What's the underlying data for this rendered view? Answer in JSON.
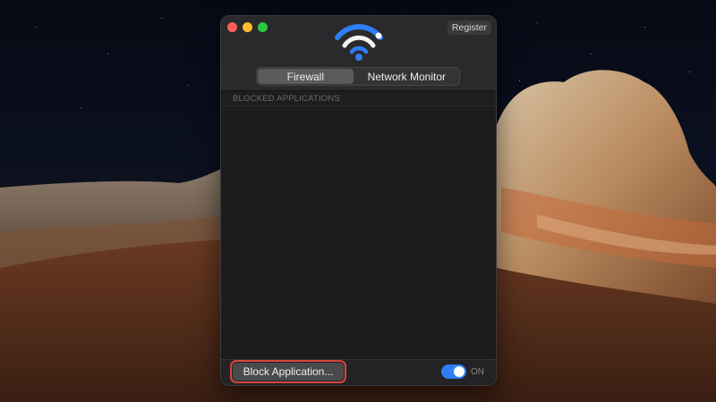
{
  "window": {
    "register_label": "Register"
  },
  "tabs": [
    {
      "label": "Firewall",
      "active": true
    },
    {
      "label": "Network Monitor",
      "active": false
    }
  ],
  "list": {
    "header": "BLOCKED APPLICATIONS",
    "items": []
  },
  "footer": {
    "block_button_label": "Block Application...",
    "toggle_state": "on",
    "toggle_label": "ON"
  },
  "icons": {
    "app": "wifi-logo-icon"
  },
  "colors": {
    "accent": "#2f7ef5",
    "logo_blue": "#2f7ef5",
    "logo_white": "#f2f2f2",
    "highlight_border": "#d9443b"
  }
}
